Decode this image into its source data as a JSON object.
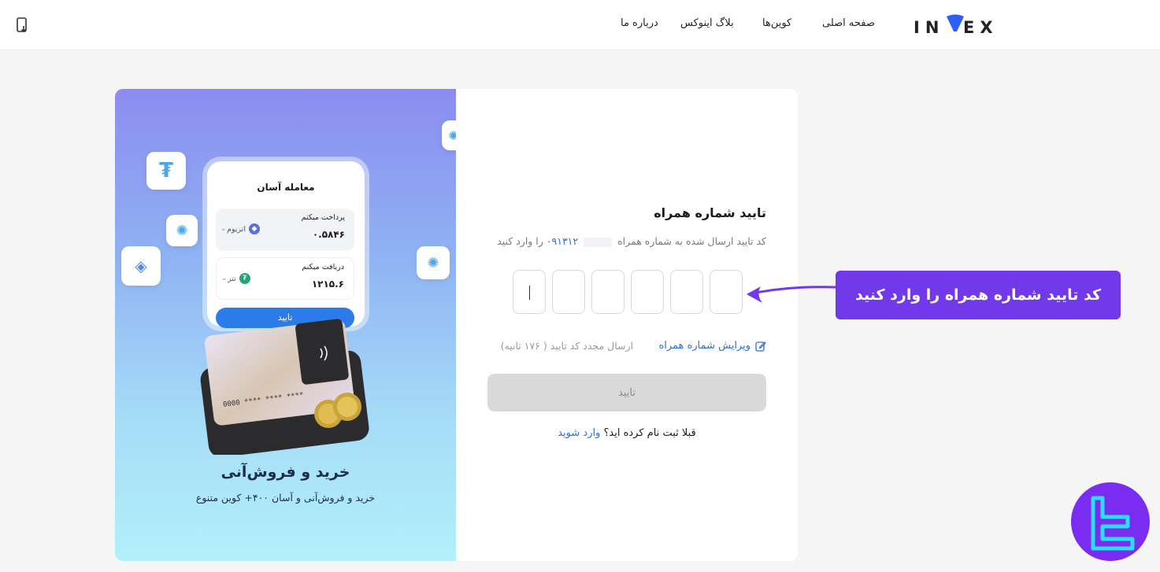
{
  "header": {
    "logo_left": "IN",
    "logo_right": "EX",
    "nav": [
      "صفحه اصلی",
      "کوین‌ها",
      "بلاگ اینوکس",
      "درباره ما"
    ],
    "download_icon": "download-app-icon"
  },
  "promo": {
    "phone": {
      "title": "معامله آسان",
      "pay_label": "پرداخت میکنم",
      "pay_amount": "۰.۵۸۴۶",
      "pay_coin": "اتریوم",
      "receive_label": "دریافت میکنم",
      "receive_amount": "۱۲۱۵.۶",
      "receive_coin": "تتر",
      "button": "تایید"
    },
    "card_number": "0000 **** **** ****",
    "title": "خرید و فروش‌آنی",
    "subtitle": "خرید و فروش‌آنی و آسان ۴۰۰+ کوین متنوع",
    "icons": [
      "tether-icon",
      "cardano-icon",
      "binance-icon",
      "cardano-icon",
      "cardano-icon"
    ]
  },
  "form": {
    "title": "تایید شماره همراه",
    "desc_before": "کد تایید ارسال شده به شماره همراه",
    "phone_number": "۰۹۱۳۱۲",
    "desc_after": "را وارد کنید",
    "otp_count": 6,
    "edit_link": "ویرایش شماره همراه",
    "resend": "ارسال مجدد کد تایید ( ۱۷۶ ثانیه)",
    "submit": "تایید",
    "login_question": "قبلا ثبت نام کرده اید؟",
    "login_link": "وارد شوید"
  },
  "annotation": {
    "callout": "کد تایید شماره همراه را وارد کنید"
  },
  "colors": {
    "accent": "#7239ea",
    "link": "#2c6fd6",
    "logo_v": "#2c5ff5"
  }
}
